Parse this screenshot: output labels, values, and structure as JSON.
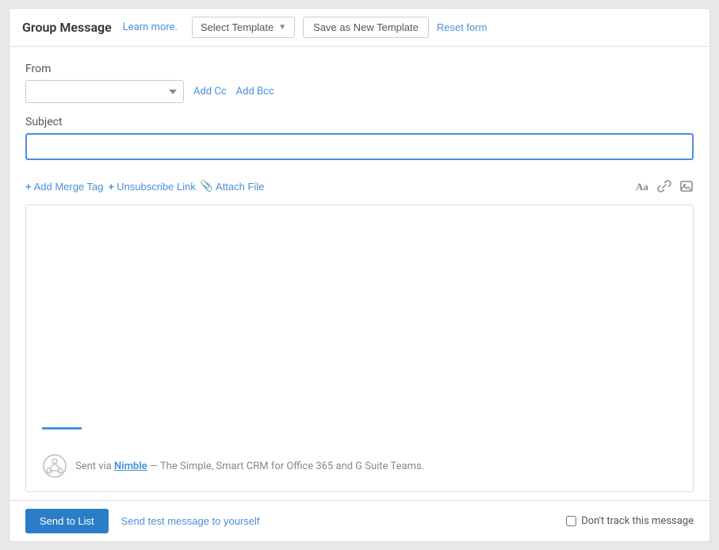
{
  "header": {
    "title": "Group Message",
    "learn_more": "Learn more.",
    "select_template": "Select Template",
    "save_template": "Save as New Template",
    "reset_form": "Reset form"
  },
  "from_section": {
    "label": "From",
    "add_cc": "Add Cc",
    "add_bcc": "Add Bcc"
  },
  "subject_section": {
    "label": "Subject",
    "placeholder": ""
  },
  "toolbar": {
    "add_merge_tag": "Add Merge Tag",
    "unsubscribe_link": "Unsubscribe Link",
    "attach_file": "Attach File"
  },
  "nimble_footer": {
    "text": "Sent via ",
    "brand": "Nimble",
    "rest": " — The Simple, Smart CRM for Office 365 and G Suite Teams."
  },
  "footer": {
    "send_btn": "Send to List",
    "send_test": "Send test message to yourself",
    "dont_track": "Don't track this message"
  }
}
